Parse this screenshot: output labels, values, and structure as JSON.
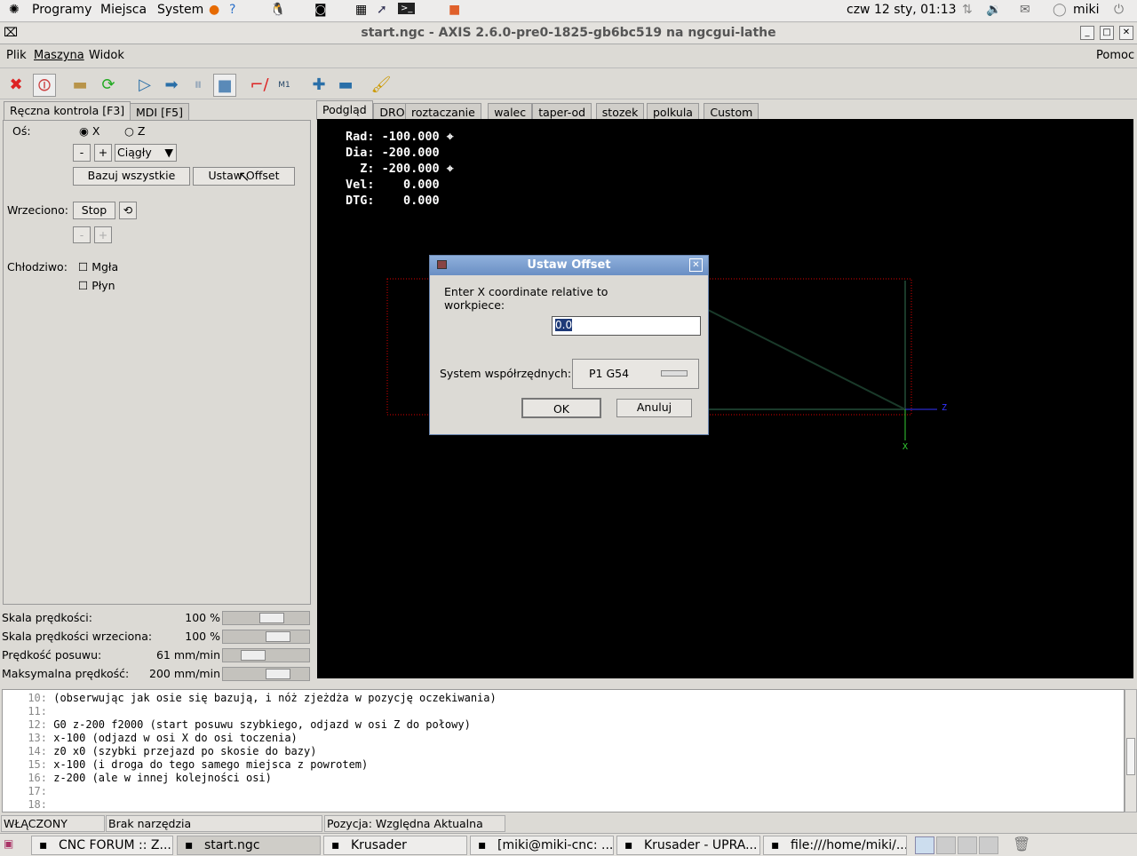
{
  "topbar": {
    "menus": [
      "Programy",
      "Miejsca",
      "System"
    ],
    "clock": "czw 12 sty, 01:13",
    "user": "miki"
  },
  "window": {
    "title": "start.ngc - AXIS 2.6.0-pre0-1825-gb6bc519 na ngcgui-lathe"
  },
  "menubar": {
    "items": [
      "Plik",
      "Maszyna",
      "Widok"
    ],
    "help": "Pomoc"
  },
  "toolbar": {
    "icons": [
      "estop-icon",
      "power-icon",
      "open-file-icon",
      "reload-icon",
      "run-icon",
      "step-icon",
      "pause-icon",
      "stop-icon",
      "run-from-line-icon",
      "optional-stop-icon",
      "zoom-in-icon",
      "zoom-out-icon",
      "clear-plot-icon"
    ],
    "m1_label": "M1"
  },
  "left_tabs": [
    "Ręczna kontrola [F3]",
    "MDI [F5]"
  ],
  "manual": {
    "axis_label": "Oś:",
    "axis_x": "X",
    "axis_z": "Z",
    "axis_selected": "X",
    "minus": "-",
    "plus": "+",
    "jog_mode": "Ciągły",
    "home_all": "Bazuj wszystkie",
    "set_offset": "Ustaw Offset",
    "spindle_label": "Wrzeciono:",
    "spindle_stop": "Stop",
    "coolant_label": "Chłodziwo:",
    "mist": "Mgła",
    "flood": "Płyn"
  },
  "overrides": [
    {
      "label": "Skala prędkości:",
      "value": "100 %",
      "fraction": 0.6
    },
    {
      "label": "Skala prędkości wrzeciona:",
      "value": "100 %",
      "fraction": 0.7
    },
    {
      "label": "Prędkość posuwu:",
      "value": "61 mm/min",
      "fraction": 0.3
    },
    {
      "label": "Maksymalna prędkość:",
      "value": "200 mm/min",
      "fraction": 0.7
    }
  ],
  "right_tabs": [
    "Podgląd",
    "DRO",
    "roztaczanie",
    "walec",
    "taper-od",
    "stozek",
    "polkula",
    "Custom"
  ],
  "dro": [
    {
      "label": "Rad:",
      "value": "-100.000",
      "homed": true
    },
    {
      "label": "Dia:",
      "value": "-200.000",
      "homed": false
    },
    {
      "label": "  Z:",
      "value": "-200.000",
      "homed": true
    },
    {
      "label": "Vel:",
      "value": "   0.000",
      "homed": false
    },
    {
      "label": "DTG:",
      "value": "   0.000",
      "homed": false
    }
  ],
  "plot": {
    "axis_z": "Z",
    "axis_x": "X"
  },
  "dialog": {
    "title": "Ustaw Offset",
    "prompt": "Enter X coordinate relative to workpiece:",
    "value": "0.0",
    "system_label": "System współrzędnych:",
    "system_value": "P1  G54",
    "ok": "OK",
    "cancel": "Anuluj"
  },
  "code": [
    {
      "n": "10:",
      "t": "(obserwując jak osie się bazują, i nóż zjeżdża w pozycję oczekiwania)"
    },
    {
      "n": "11:",
      "t": ""
    },
    {
      "n": "12:",
      "t": "G0 z-200 f2000 (start posuwu szybkiego, odjazd w osi Z do połowy)"
    },
    {
      "n": "13:",
      "t": "x-100 (odjazd w osi X do osi toczenia)"
    },
    {
      "n": "14:",
      "t": "z0 x0 (szybki przejazd po skosie do bazy)"
    },
    {
      "n": "15:",
      "t": "x-100 (i droga do tego samego miejsca z powrotem)"
    },
    {
      "n": "16:",
      "t": "z-200 (ale w innej kolejności osi)"
    },
    {
      "n": "17:",
      "t": ""
    },
    {
      "n": "18:",
      "t": ""
    }
  ],
  "status": {
    "state": "WŁĄCZONY",
    "tool": "Brak narzędzia",
    "position": "Pozycja: Względna Aktualna"
  },
  "taskbar": [
    "CNC FORUM :: Z...",
    "start.ngc",
    "Krusader",
    "[miki@miki-cnc: ...",
    "Krusader - UPRA...",
    "file:///home/miki/..."
  ]
}
